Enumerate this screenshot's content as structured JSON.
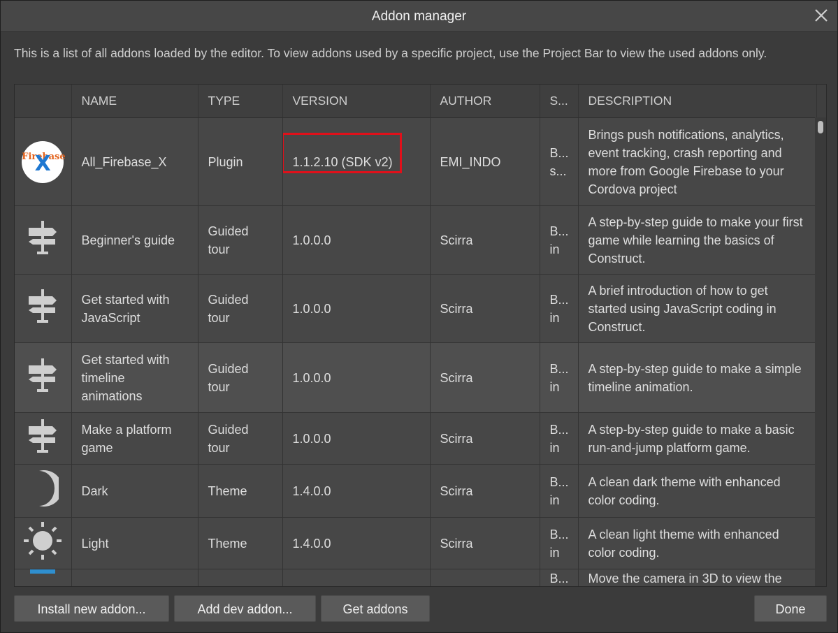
{
  "window": {
    "title": "Addon manager"
  },
  "intro_text": "This is a list of all addons loaded by the editor. To view addons used by a specific project, use the Project Bar to view the used addons only.",
  "table": {
    "columns": {
      "name": "NAME",
      "type": "TYPE",
      "version": "VERSION",
      "author": "AUTHOR",
      "s": "S...",
      "description": "DESCRIPTION"
    },
    "rows": [
      {
        "icon": "firebase-x-logo-icon",
        "icon_text": "Firebase",
        "icon_mark": "X",
        "name": "All_Firebase_X",
        "type": "Plugin",
        "version": "1.1.2.10 (SDK v2)",
        "author": "EMI_INDO",
        "s": "B...\ns...",
        "description": "Brings push notifications, analytics, event tracking, crash reporting and more from Google Firebase to your Cordova project"
      },
      {
        "icon": "signpost-icon",
        "name": "Beginner's guide",
        "type": "Guided tour",
        "version": "1.0.0.0",
        "author": "Scirra",
        "s": "B...\nin",
        "description": "A step-by-step guide to make your first game while learning the basics of Construct."
      },
      {
        "icon": "signpost-icon",
        "name": "Get started with JavaScript",
        "type": "Guided tour",
        "version": "1.0.0.0",
        "author": "Scirra",
        "s": "B...\nin",
        "description": "A brief introduction of how to get started using JavaScript coding in Construct."
      },
      {
        "icon": "signpost-icon",
        "name": "Get started with timeline animations",
        "type": "Guided tour",
        "version": "1.0.0.0",
        "author": "Scirra",
        "s": "B...\nin",
        "description": "A step-by-step guide to make a simple timeline animation."
      },
      {
        "icon": "signpost-icon",
        "name": "Make a platform game",
        "type": "Guided tour",
        "version": "1.0.0.0",
        "author": "Scirra",
        "s": "B...\nin",
        "description": "A step-by-step guide to make a basic run-and-jump platform game."
      },
      {
        "icon": "moon-icon",
        "name": "Dark",
        "type": "Theme",
        "version": "1.4.0.0",
        "author": "Scirra",
        "s": "B...\nin",
        "description": "A clean dark theme with enhanced color coding."
      },
      {
        "icon": "sun-icon",
        "name": "Light",
        "type": "Theme",
        "version": "1.4.0.0",
        "author": "Scirra",
        "s": "B...\nin",
        "description": "A clean light theme with enhanced color coding."
      },
      {
        "icon": "camera-3d-icon",
        "name": "",
        "type": "",
        "version": "",
        "author": "",
        "s": "B...",
        "description": "Move the camera in 3D to view the"
      }
    ]
  },
  "buttons": {
    "install": "Install new addon...",
    "dev": "Add dev addon...",
    "get": "Get addons",
    "done": "Done"
  },
  "colors": {
    "highlight_box": "#e0101a",
    "dialog_bg": "#3b3b3b",
    "row_bg": "#474747"
  }
}
